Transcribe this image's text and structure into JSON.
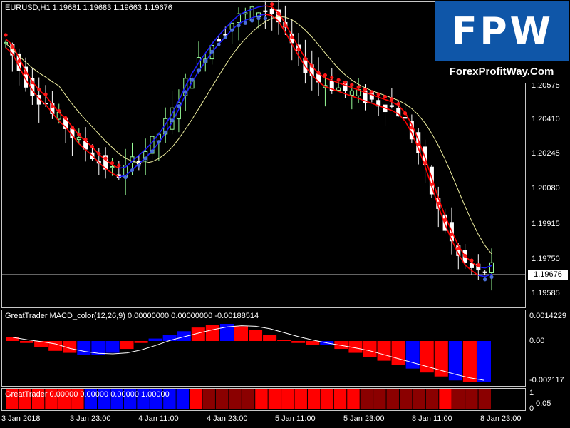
{
  "main_chart": {
    "title": "EURUSD,H1  1.19681 1.19683 1.19663 1.19676",
    "price_labels": [
      "1.20575",
      "1.20410",
      "1.20245",
      "1.20080",
      "1.19915",
      "1.19750",
      "1.19585"
    ],
    "current_price": "1.19676"
  },
  "macd_pane": {
    "title": "GreatTrader MACD_color(12,26,9) 0.00000000 0.00000000 -0.00188514",
    "axis_labels": [
      "0.0014229",
      "0.00",
      "-0.002117"
    ]
  },
  "gt_pane": {
    "title": "GreatTrader 0.00000 0.00000 0.00000 1.00000",
    "axis_labels": [
      "1",
      "0.05",
      "0"
    ]
  },
  "time_axis": [
    "3 Jan 2018",
    "3 Jan 23:00",
    "4 Jan 11:00",
    "4 Jan 23:00",
    "5 Jan 11:00",
    "5 Jan 23:00",
    "8 Jan 11:00",
    "8 Jan 23:00"
  ],
  "logo": {
    "text": "FPW",
    "site": "ForexProfitWay.Com"
  },
  "colors": {
    "background": "#000000",
    "bull_candle": "#98fb98",
    "bear_candle": "#ffffff",
    "red_band": "#ff0000",
    "blue_band": "#1c1cff",
    "moving_average": "#f0f0a0",
    "dots_red": "#ff1a1a",
    "dots_blue": "#4a6fd8",
    "hist_red": "#ff0000",
    "hist_blue": "#0000ff",
    "strip_red": "#ff0000",
    "strip_darkred": "#8b0000",
    "strip_blue": "#0000ff"
  },
  "chart_data": {
    "type": "candlestick",
    "symbol": "EURUSD",
    "timeframe": "H1",
    "last_ohlc": {
      "open": 1.19681,
      "high": 1.19683,
      "low": 1.19663,
      "close": 1.19676
    },
    "ylim": [
      1.1952,
      1.208
    ],
    "close": [
      1.2063,
      1.2058,
      1.2052,
      1.2047,
      1.2043,
      1.204,
      1.2038,
      1.2033,
      1.2031,
      1.2028,
      1.2024,
      1.2021,
      1.2019,
      1.2016,
      1.2013,
      1.2011,
      1.2009,
      1.2008,
      1.201,
      1.2013,
      1.2015,
      1.2018,
      1.2021,
      1.2025,
      1.2029,
      1.2034,
      1.204,
      1.2046,
      1.2051,
      1.2055,
      1.2059,
      1.2063,
      1.2066,
      1.2069,
      1.2072,
      1.2074,
      1.2075,
      1.2076,
      1.2077,
      1.2077,
      1.2076,
      1.2072,
      1.2067,
      1.2062,
      1.2057,
      1.2053,
      1.205,
      1.2047,
      1.2046,
      1.2045,
      1.2044,
      1.2043,
      1.2042,
      1.2041,
      1.204,
      1.2039,
      1.2038,
      1.2037,
      1.2036,
      1.2034,
      1.203,
      1.2024,
      1.2017,
      1.2009,
      1.2,
      1.1992,
      1.1985,
      1.1979,
      1.1973,
      1.197,
      1.1968,
      1.1966,
      1.1967,
      1.1968
    ],
    "macd_histogram": [
      0.0003,
      -0.0001,
      -0.0003,
      -0.0005,
      -0.0006,
      -0.0007,
      -0.0007,
      -0.0006,
      -0.0004,
      -0.0001,
      0.0002,
      0.0005,
      0.0008,
      0.0011,
      0.0013,
      0.0014,
      0.0012,
      0.0009,
      0.0005,
      0.0001,
      -0.0001,
      -0.0002,
      -0.0002,
      -0.0004,
      -0.0006,
      -0.0008,
      -0.001,
      -0.0012,
      -0.0014,
      -0.0016,
      -0.0018,
      -0.002,
      -0.0021,
      -0.0021
    ],
    "macd_hist_colors": [
      "red",
      "red",
      "red",
      "red",
      "red",
      "blue",
      "blue",
      "blue",
      "red",
      "red",
      "blue",
      "blue",
      "blue",
      "red",
      "red",
      "blue",
      "red",
      "red",
      "red",
      "red",
      "red",
      "red",
      "blue",
      "red",
      "red",
      "red",
      "red",
      "red",
      "blue",
      "red",
      "red",
      "blue",
      "red",
      "blue"
    ],
    "gt_strip_colors": [
      "red",
      "red",
      "red",
      "red",
      "red",
      "red",
      "blue",
      "blue",
      "blue",
      "blue",
      "blue",
      "blue",
      "blue",
      "blue",
      "red",
      "darkred",
      "darkred",
      "darkred",
      "darkred",
      "red",
      "red",
      "red",
      "red",
      "red",
      "red",
      "red",
      "red",
      "darkred",
      "darkred",
      "darkred",
      "darkred",
      "darkred",
      "darkred",
      "red",
      "darkred",
      "darkred",
      "darkred"
    ]
  }
}
